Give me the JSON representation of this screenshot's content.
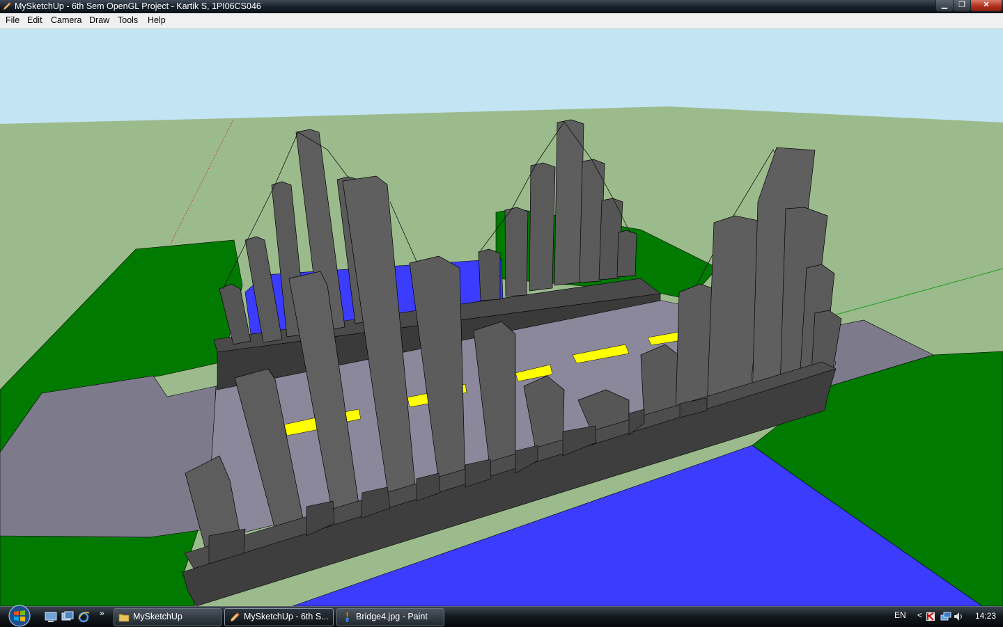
{
  "window": {
    "title": "MySketchUp - 6th Sem OpenGL Project - Kartik S, 1PI06CS046",
    "min_glyph": "▁",
    "max_glyph": "❐",
    "close_glyph": "✕",
    "app_icon": "pencil-icon"
  },
  "menubar": {
    "items": [
      "File",
      "Edit",
      "Camera",
      "Draw",
      "Tools",
      "Help"
    ]
  },
  "scene": {
    "description_icon": "3d-viewport",
    "colors": {
      "sky": "#c2e4f3",
      "ground": "#9cbb8d",
      "grass": "#007a00",
      "water": "#3c3cff",
      "road": "#7d7a8c",
      "building": "#5a5a5a",
      "building_dark": "#3c3c3c",
      "lane_marking": "#ffff00"
    }
  },
  "taskbar": {
    "quick_launch": [
      "show-desktop-icon",
      "switch-windows-icon",
      "internet-explorer-icon"
    ],
    "more": "»",
    "tasks": [
      {
        "label": "MySketchUp",
        "icon": "folder-icon",
        "active": false
      },
      {
        "label": "MySketchUp - 6th S...",
        "icon": "pencil-icon",
        "active": true
      },
      {
        "label": "Bridge4.jpg - Paint",
        "icon": "paint-icon",
        "active": false
      }
    ],
    "tray": {
      "language": "EN",
      "chevron": "<",
      "time": "14:23"
    }
  }
}
